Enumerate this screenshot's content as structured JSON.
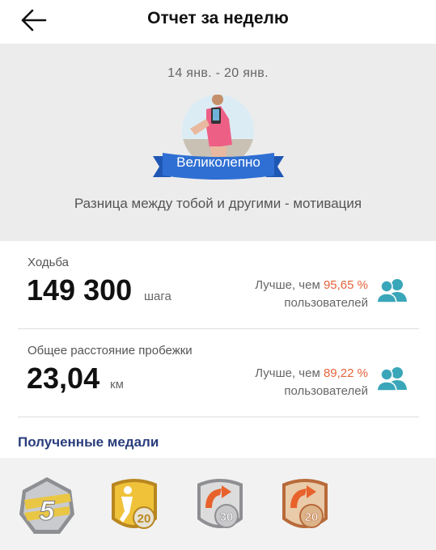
{
  "header": {
    "title": "Отчет за неделю"
  },
  "hero": {
    "date_range": "14 янв. - 20 янв.",
    "badge": "Великолепно",
    "motivation": "Разница между тобой и другими - мотивация"
  },
  "walking": {
    "label": "Ходьба",
    "value": "149 300",
    "unit": "шага",
    "better_than": "Лучше, чем",
    "percent": "95,65 %",
    "users": "пользователей"
  },
  "running": {
    "label": "Общее расстояние пробежки",
    "value": "23,04",
    "unit": "км",
    "better_than": "Лучше, чем",
    "percent": "89,22 %",
    "users": "пользователей"
  },
  "medals": {
    "title": "Полученные медали",
    "items": [
      {
        "icon": "silver-5-medal-icon",
        "text": "5"
      },
      {
        "icon": "gold-walker-20-medal-icon",
        "text": "20"
      },
      {
        "icon": "runner-30-medal-icon",
        "text": "30"
      },
      {
        "icon": "runner-20-medal-icon",
        "text": "20"
      }
    ]
  },
  "colors": {
    "accent_percent": "#e4643a",
    "users_icon": "#3aa6b9",
    "badge_ribbon": "#2f6fd3",
    "medals_title": "#2a3d7c"
  }
}
